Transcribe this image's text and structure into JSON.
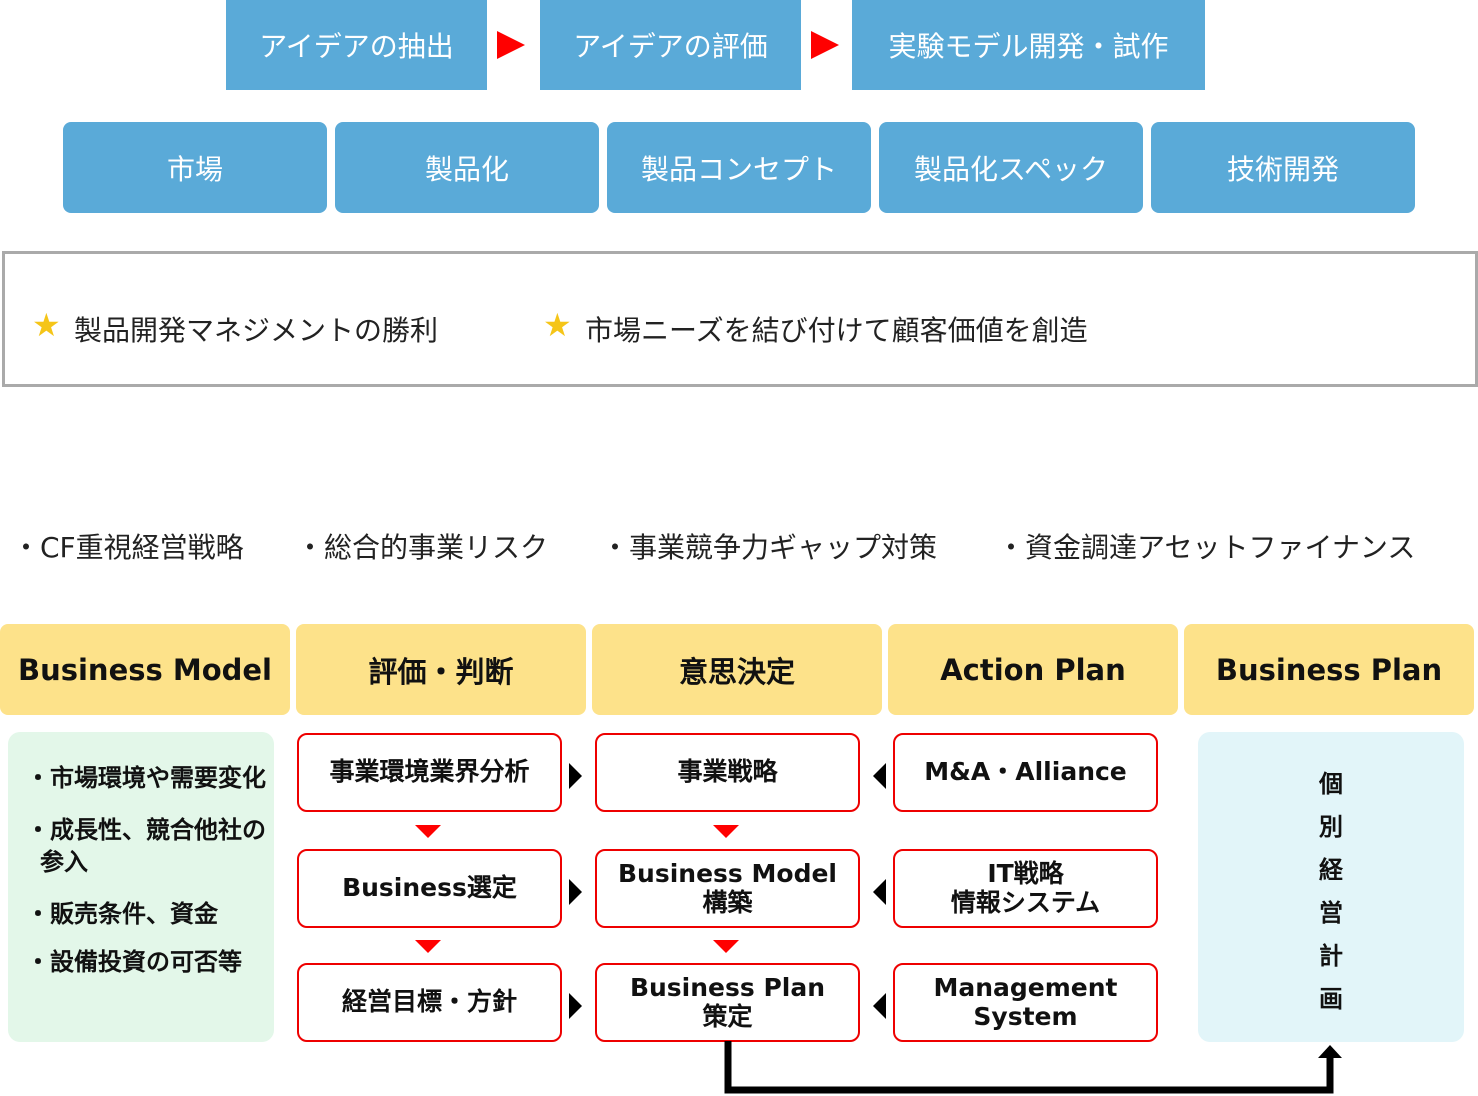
{
  "top_flow": [
    "アイデアの抽出",
    "アイデアの評価",
    "実験モデル開発・試作"
  ],
  "stages": [
    "市場",
    "製品化",
    "製品コンセプト",
    "製品化スペック",
    "技術開発"
  ],
  "goals": [
    "製品開発マネジメントの勝利",
    "市場ニーズを結び付けて顧客価値を創造"
  ],
  "bullets": [
    "・CF重視経営戦略",
    "・総合的事業リスク",
    "・事業競争力ギャップ対策",
    "・資金調達アセットファイナンス"
  ],
  "headers": [
    "Business Model",
    "評価・判断",
    "意思決定",
    "Action Plan",
    "Business Plan"
  ],
  "left_items": [
    "・市場環境や需要変化",
    "・成長性、競合他社の参入",
    "・販売条件、資金",
    "・設備投資の可否等"
  ],
  "col1": [
    "事業環境業界分析",
    "Business選定",
    "経営目標・方針"
  ],
  "col2": [
    [
      "事業戦略"
    ],
    [
      "Business Model",
      "構築"
    ],
    [
      "Business Plan",
      "策定"
    ]
  ],
  "col3": [
    [
      "M&A・Alliance"
    ],
    [
      "IT戦略",
      "情報システム"
    ],
    [
      "Management",
      "System"
    ]
  ],
  "right_vertical": [
    "個",
    "別",
    "経",
    "営",
    "計",
    "画"
  ],
  "colors": {
    "blue": "#5aaad8",
    "yellow": "#fde28a",
    "green": "#e3f7e9",
    "light_blue": "#e2f5f9",
    "red": "#ee0000",
    "star": "#f5c518"
  }
}
